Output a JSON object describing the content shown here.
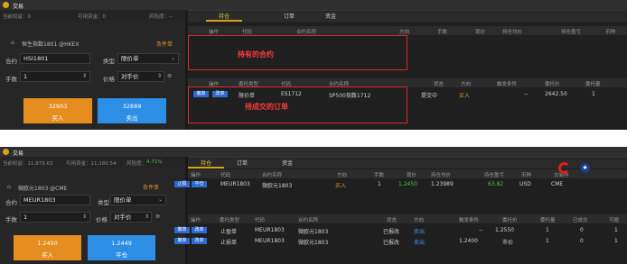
{
  "window": {
    "title": "交易"
  },
  "panel1": {
    "account": {
      "equity_label": "当前权益：0",
      "available_label": "可用资金：0",
      "risk_label": "风险度：--"
    },
    "tabs": [
      "持仓",
      "订单",
      "资金"
    ],
    "instrument": {
      "name": "恒生指数1801 @HKEX",
      "condition_btn": "条件单"
    },
    "form": {
      "contract_label": "合约",
      "contract_value": "HSI1801",
      "type_label": "类型",
      "type_value": "限价单",
      "qty_label": "手数",
      "qty_value": "1",
      "price_label": "价格",
      "price_value": "对手价"
    },
    "buy": {
      "price": "32903",
      "label": "买入"
    },
    "sell": {
      "price": "32889",
      "label": "卖出"
    },
    "positions_header": [
      "操作",
      "代码",
      "合约名称",
      "方向",
      "手数",
      "现价",
      "持仓均价",
      "持仓盈亏",
      "币种"
    ],
    "orders_header": [
      "操作",
      "委托类型",
      "代码",
      "合约名称",
      "状态",
      "方向",
      "触发条件",
      "委托价",
      "委托量"
    ],
    "order_row": {
      "op1": "撤单",
      "op2": "改单",
      "type": "限价单",
      "code": "ES1712",
      "name": "SP500指数1712",
      "status": "提交中",
      "side": "买入",
      "trigger": "--",
      "price": "2642.50",
      "qty": "1"
    },
    "annotations": {
      "positions": "持有的合约",
      "orders": "待成交的订单"
    }
  },
  "panel2": {
    "account": {
      "equity_label": "当前权益：11,879.63",
      "available_label": "可用资金：11,180.54",
      "risk_label": "风险度：",
      "risk_value": "4.71%"
    },
    "tabs": [
      "持仓",
      "订单",
      "资金"
    ],
    "instrument": {
      "name": "微欧元1803 @CME",
      "condition_btn": "条件单"
    },
    "form": {
      "contract_label": "合约",
      "contract_value": "MEUR1803",
      "type_label": "类型",
      "type_value": "限价单",
      "qty_label": "手数",
      "qty_value": "1",
      "price_label": "价格",
      "price_value": "对手价"
    },
    "buy": {
      "price": "1.2450",
      "label": "买入"
    },
    "sell": {
      "price": "1.2449",
      "label": "平仓"
    },
    "positions_header": [
      "操作",
      "代码",
      "合约名称",
      "方向",
      "手数",
      "现价",
      "持仓均价",
      "持仓盈亏",
      "币种",
      "交易所"
    ],
    "position_row": {
      "op1": "止损",
      "op2": "平仓",
      "code": "MEUR1803",
      "name": "微欧元1803",
      "side": "买入",
      "qty": "1",
      "price": "1.2450",
      "avg": "1.23989",
      "pnl": "63.82",
      "ccy": "USD",
      "exch": "CME"
    },
    "orders_header": [
      "操作",
      "委托类型",
      "代码",
      "合约名称",
      "状态",
      "方向",
      "触发条件",
      "委托价",
      "委托量",
      "已成交",
      "可撤"
    ],
    "order_rows": [
      {
        "op1": "撤单",
        "op2": "改单",
        "type": "止盈单",
        "code": "MEUR1803",
        "name": "微欧元1803",
        "status": "已报改",
        "side": "卖出",
        "trigger": "--",
        "price": "1.2550",
        "qty": "1",
        "filled": "0",
        "cancel": "1"
      },
      {
        "op1": "撤单",
        "op2": "改单",
        "type": "止损单",
        "code": "MEUR1803",
        "name": "微欧元1803",
        "status": "已报改",
        "side": "卖出",
        "trigger": "1.2400",
        "price": "市价",
        "qty": "1",
        "filled": "0",
        "cancel": "1"
      }
    ]
  }
}
